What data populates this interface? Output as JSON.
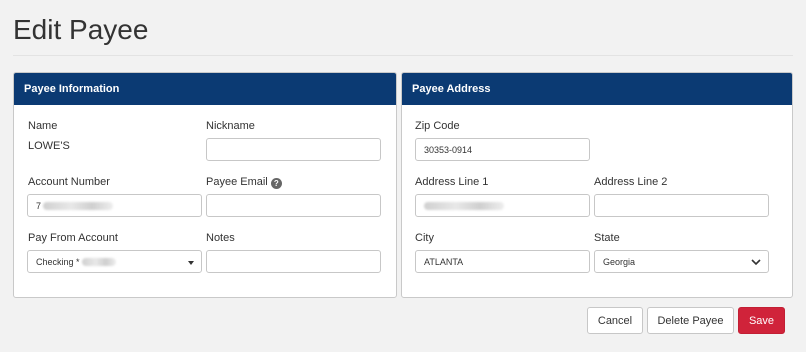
{
  "page": {
    "title": "Edit Payee"
  },
  "payee_info": {
    "header": "Payee Information",
    "name_label": "Name",
    "name_value": "LOWE'S",
    "nickname_label": "Nickname",
    "nickname_value": "",
    "account_number_label": "Account Number",
    "account_number_prefix": "7",
    "payee_email_label": "Payee Email",
    "payee_email_value": "",
    "help_icon_glyph": "?",
    "pay_from_label": "Pay From Account",
    "pay_from_value": "Checking *",
    "notes_label": "Notes",
    "notes_value": ""
  },
  "payee_address": {
    "header": "Payee Address",
    "zip_label": "Zip Code",
    "zip_value": "30353-0914",
    "address1_label": "Address Line 1",
    "address2_label": "Address Line 2",
    "address2_value": "",
    "city_label": "City",
    "city_value": "ATLANTA",
    "state_label": "State",
    "state_value": "Georgia"
  },
  "actions": {
    "cancel": "Cancel",
    "delete": "Delete Payee",
    "save": "Save"
  },
  "colors": {
    "panel_header": "#0b3a73",
    "save_button": "#d0233a"
  },
  "icons": [
    "help-icon",
    "caret-down-icon",
    "chevron-down-icon"
  ]
}
